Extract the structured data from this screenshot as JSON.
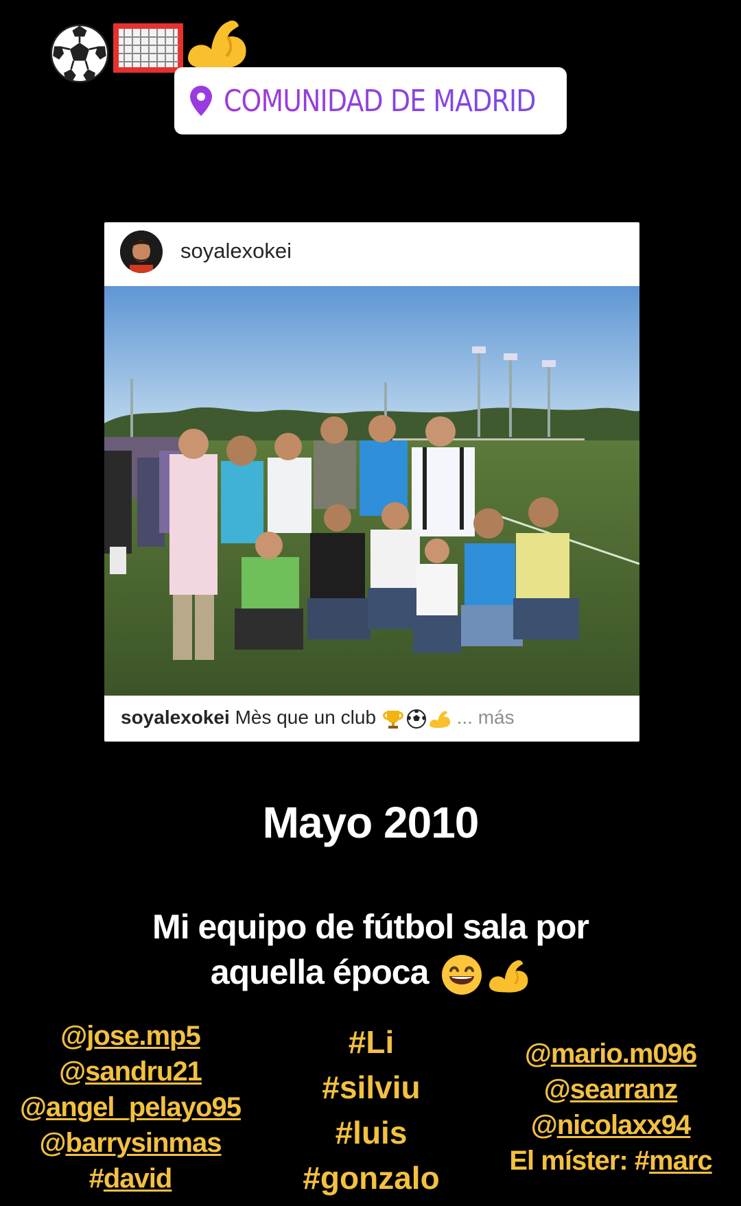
{
  "stickers": [
    "soccer-ball-emoji",
    "goal-net-emoji",
    "flexed-biceps-emoji"
  ],
  "location": {
    "icon": "map-pin-icon",
    "label": "COMUNIDAD DE MADRID",
    "color": "#8b3ee0"
  },
  "post": {
    "username": "soyalexokei",
    "caption_user": "soyalexokei",
    "caption_text": "Mès que un club",
    "caption_emojis": [
      "trophy-emoji",
      "soccer-ball-emoji",
      "flexed-biceps-emoji"
    ],
    "caption_more": "... más"
  },
  "story": {
    "date": "Mayo 2010",
    "description_line1": "Mi equipo de fútbol sala por",
    "description_line2": "aquella época",
    "description_emojis": [
      "grinning-face-emoji",
      "flexed-biceps-emoji"
    ]
  },
  "mentions": {
    "left_col": [
      {
        "prefix": "@",
        "handle": "jose.mp5"
      },
      {
        "prefix": "@",
        "handle": "sandru21"
      },
      {
        "prefix": "@",
        "handle": "angel_pelayo95"
      },
      {
        "prefix": "@",
        "handle": "barrysinmas"
      },
      {
        "prefix": "#",
        "handle": "david"
      }
    ],
    "mid_col": [
      "#Li",
      "#silviu",
      "#luis",
      "#gonzalo"
    ],
    "right_col": [
      {
        "prefix": "@",
        "handle": "mario.m096"
      },
      {
        "prefix": "@",
        "handle": "searranz"
      },
      {
        "prefix": "@",
        "handle": "nicolaxx94"
      }
    ],
    "coach_label": "El míster: #",
    "coach_handle": "marc",
    "color": "#f3c040"
  }
}
